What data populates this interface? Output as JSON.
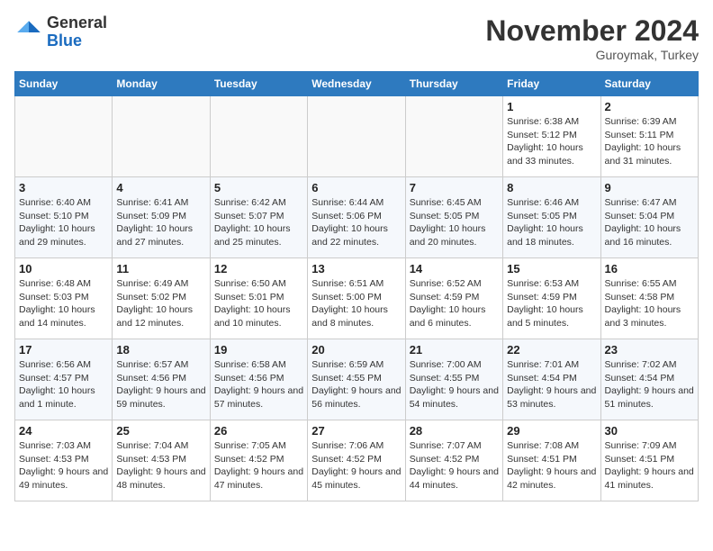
{
  "header": {
    "logo_general": "General",
    "logo_blue": "Blue",
    "month_title": "November 2024",
    "location": "Guroymak, Turkey"
  },
  "days_of_week": [
    "Sunday",
    "Monday",
    "Tuesday",
    "Wednesday",
    "Thursday",
    "Friday",
    "Saturday"
  ],
  "weeks": [
    [
      {
        "day": "",
        "info": ""
      },
      {
        "day": "",
        "info": ""
      },
      {
        "day": "",
        "info": ""
      },
      {
        "day": "",
        "info": ""
      },
      {
        "day": "",
        "info": ""
      },
      {
        "day": "1",
        "info": "Sunrise: 6:38 AM\nSunset: 5:12 PM\nDaylight: 10 hours and 33 minutes."
      },
      {
        "day": "2",
        "info": "Sunrise: 6:39 AM\nSunset: 5:11 PM\nDaylight: 10 hours and 31 minutes."
      }
    ],
    [
      {
        "day": "3",
        "info": "Sunrise: 6:40 AM\nSunset: 5:10 PM\nDaylight: 10 hours and 29 minutes."
      },
      {
        "day": "4",
        "info": "Sunrise: 6:41 AM\nSunset: 5:09 PM\nDaylight: 10 hours and 27 minutes."
      },
      {
        "day": "5",
        "info": "Sunrise: 6:42 AM\nSunset: 5:07 PM\nDaylight: 10 hours and 25 minutes."
      },
      {
        "day": "6",
        "info": "Sunrise: 6:44 AM\nSunset: 5:06 PM\nDaylight: 10 hours and 22 minutes."
      },
      {
        "day": "7",
        "info": "Sunrise: 6:45 AM\nSunset: 5:05 PM\nDaylight: 10 hours and 20 minutes."
      },
      {
        "day": "8",
        "info": "Sunrise: 6:46 AM\nSunset: 5:05 PM\nDaylight: 10 hours and 18 minutes."
      },
      {
        "day": "9",
        "info": "Sunrise: 6:47 AM\nSunset: 5:04 PM\nDaylight: 10 hours and 16 minutes."
      }
    ],
    [
      {
        "day": "10",
        "info": "Sunrise: 6:48 AM\nSunset: 5:03 PM\nDaylight: 10 hours and 14 minutes."
      },
      {
        "day": "11",
        "info": "Sunrise: 6:49 AM\nSunset: 5:02 PM\nDaylight: 10 hours and 12 minutes."
      },
      {
        "day": "12",
        "info": "Sunrise: 6:50 AM\nSunset: 5:01 PM\nDaylight: 10 hours and 10 minutes."
      },
      {
        "day": "13",
        "info": "Sunrise: 6:51 AM\nSunset: 5:00 PM\nDaylight: 10 hours and 8 minutes."
      },
      {
        "day": "14",
        "info": "Sunrise: 6:52 AM\nSunset: 4:59 PM\nDaylight: 10 hours and 6 minutes."
      },
      {
        "day": "15",
        "info": "Sunrise: 6:53 AM\nSunset: 4:59 PM\nDaylight: 10 hours and 5 minutes."
      },
      {
        "day": "16",
        "info": "Sunrise: 6:55 AM\nSunset: 4:58 PM\nDaylight: 10 hours and 3 minutes."
      }
    ],
    [
      {
        "day": "17",
        "info": "Sunrise: 6:56 AM\nSunset: 4:57 PM\nDaylight: 10 hours and 1 minute."
      },
      {
        "day": "18",
        "info": "Sunrise: 6:57 AM\nSunset: 4:56 PM\nDaylight: 9 hours and 59 minutes."
      },
      {
        "day": "19",
        "info": "Sunrise: 6:58 AM\nSunset: 4:56 PM\nDaylight: 9 hours and 57 minutes."
      },
      {
        "day": "20",
        "info": "Sunrise: 6:59 AM\nSunset: 4:55 PM\nDaylight: 9 hours and 56 minutes."
      },
      {
        "day": "21",
        "info": "Sunrise: 7:00 AM\nSunset: 4:55 PM\nDaylight: 9 hours and 54 minutes."
      },
      {
        "day": "22",
        "info": "Sunrise: 7:01 AM\nSunset: 4:54 PM\nDaylight: 9 hours and 53 minutes."
      },
      {
        "day": "23",
        "info": "Sunrise: 7:02 AM\nSunset: 4:54 PM\nDaylight: 9 hours and 51 minutes."
      }
    ],
    [
      {
        "day": "24",
        "info": "Sunrise: 7:03 AM\nSunset: 4:53 PM\nDaylight: 9 hours and 49 minutes."
      },
      {
        "day": "25",
        "info": "Sunrise: 7:04 AM\nSunset: 4:53 PM\nDaylight: 9 hours and 48 minutes."
      },
      {
        "day": "26",
        "info": "Sunrise: 7:05 AM\nSunset: 4:52 PM\nDaylight: 9 hours and 47 minutes."
      },
      {
        "day": "27",
        "info": "Sunrise: 7:06 AM\nSunset: 4:52 PM\nDaylight: 9 hours and 45 minutes."
      },
      {
        "day": "28",
        "info": "Sunrise: 7:07 AM\nSunset: 4:52 PM\nDaylight: 9 hours and 44 minutes."
      },
      {
        "day": "29",
        "info": "Sunrise: 7:08 AM\nSunset: 4:51 PM\nDaylight: 9 hours and 42 minutes."
      },
      {
        "day": "30",
        "info": "Sunrise: 7:09 AM\nSunset: 4:51 PM\nDaylight: 9 hours and 41 minutes."
      }
    ]
  ]
}
